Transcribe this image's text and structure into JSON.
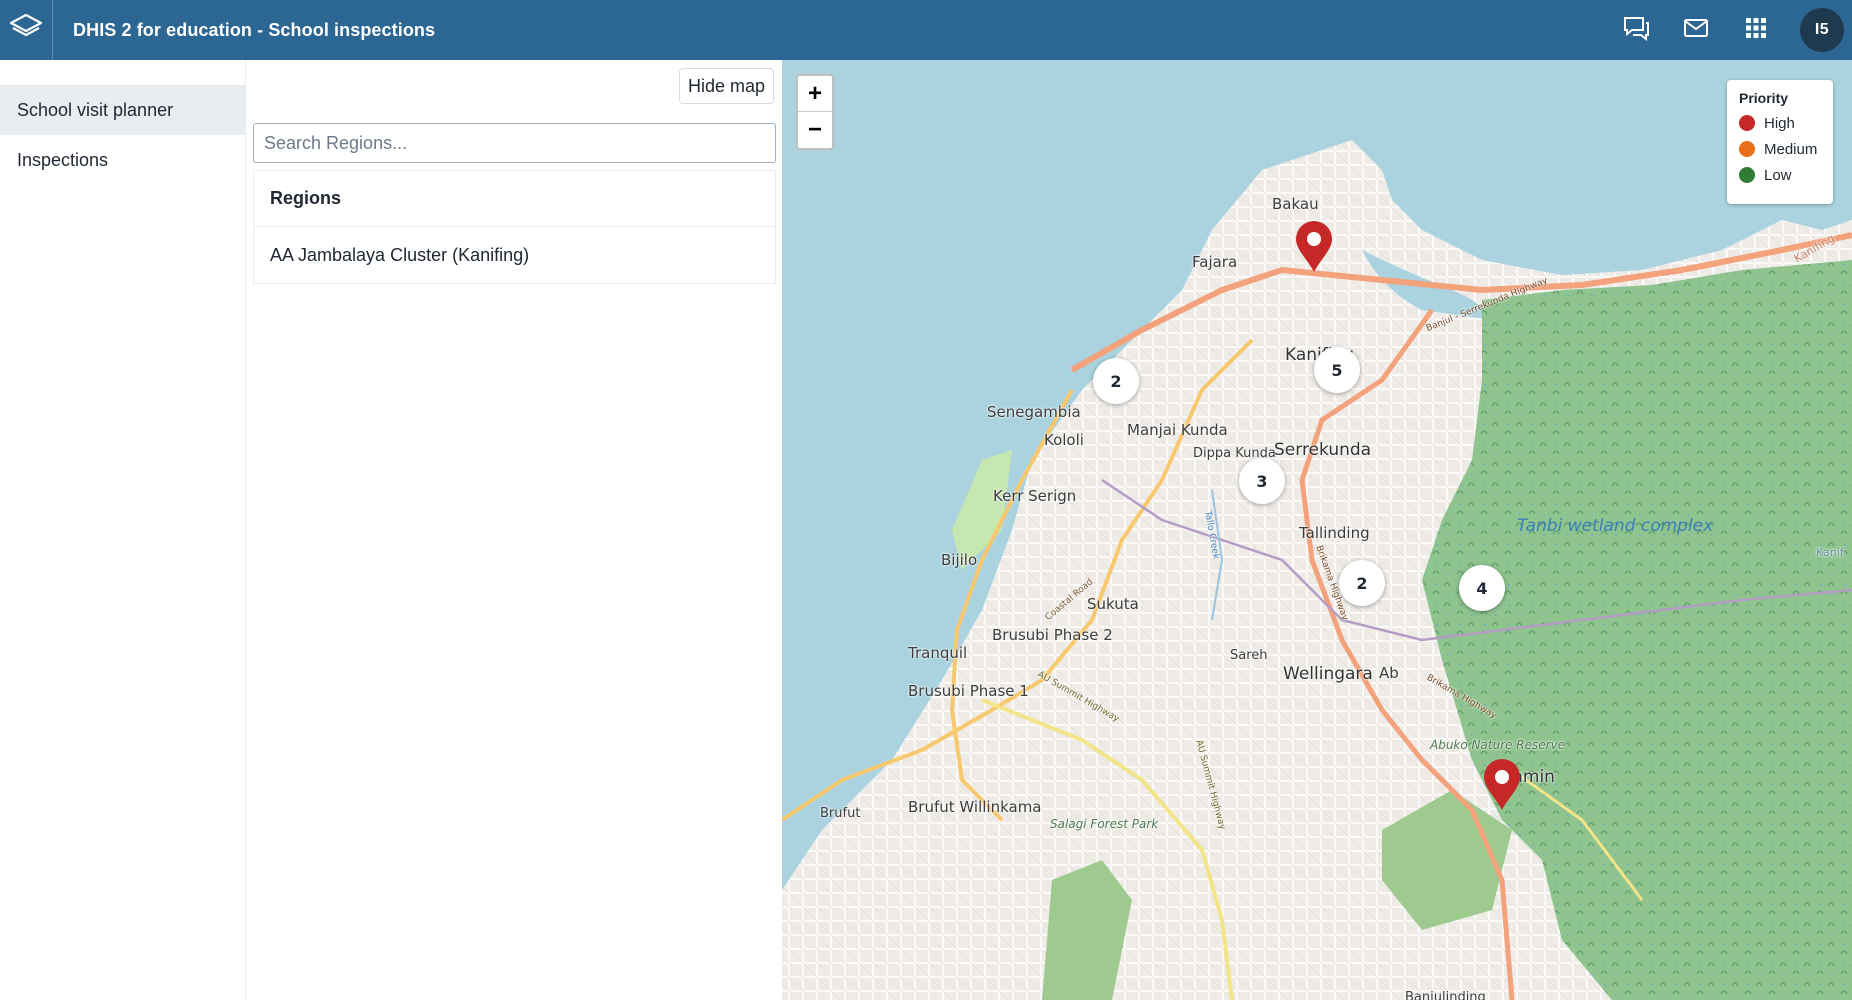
{
  "header": {
    "title": "DHIS 2 for education - School inspections",
    "profile_initials": "I5",
    "icons": [
      "logo-icon",
      "interpretations-icon",
      "messages-icon",
      "apps-icon"
    ]
  },
  "sidebar": {
    "items": [
      {
        "label": "School visit planner",
        "active": true
      },
      {
        "label": "Inspections",
        "active": false
      }
    ]
  },
  "panel": {
    "hide_map_label": "Hide map",
    "search_placeholder": "Search Regions...",
    "table_header": "Regions",
    "rows": [
      "AA Jambalaya Cluster (Kanifing)"
    ]
  },
  "map": {
    "zoom_in": "+",
    "zoom_out": "−",
    "legend": {
      "title": "Priority",
      "items": [
        {
          "label": "High",
          "color": "#c62828"
        },
        {
          "label": "Medium",
          "color": "#e8701a"
        },
        {
          "label": "Low",
          "color": "#2e7d32"
        }
      ]
    },
    "clusters": [
      "2",
      "5",
      "3",
      "2",
      "4"
    ],
    "labels": {
      "bakau": "Bakau",
      "fajara": "Fajara",
      "kanifing": "Kanifing",
      "senegambia": "Senegambia",
      "manjai": "Manjai Kunda",
      "kololi": "Kololi",
      "dippa": "Dippa Kunda",
      "serrekunda": "Serrekunda",
      "kerr": "Kerr Serign",
      "tallinding": "Tallinding",
      "bijilo": "Bijilo",
      "sukuta": "Sukuta",
      "brusubi2": "Brusubi Phase 2",
      "tranquil": "Tranquil",
      "sareh": "Sareh",
      "wellingara": "Wellingara",
      "abuko": "Ab",
      "brusubi1": "Brusubi Phase 1",
      "lamin": "Lamin",
      "brufut": "Brufut",
      "brufut_w": "Brufut Willinkama",
      "tanbi": "Tanbi wetland complex",
      "abuko_reserve": "Abuko Nature Reserve",
      "salagi": "Salagi Forest Park",
      "banjulinding": "Banjulinding",
      "kanifing_edge": "Kanifing",
      "kanif_edge": "Kanif"
    },
    "roads": {
      "banjul_serrekunda": "Banjul - Serrekunda Highway",
      "coastal": "Coastal Road",
      "au_summit": "AU Summit Highway",
      "au_summit2": "AU Summit Highway",
      "brikama": "Brikama Highway",
      "brikama2": "Brikama Highway",
      "creek": "Tallo Creek"
    }
  }
}
